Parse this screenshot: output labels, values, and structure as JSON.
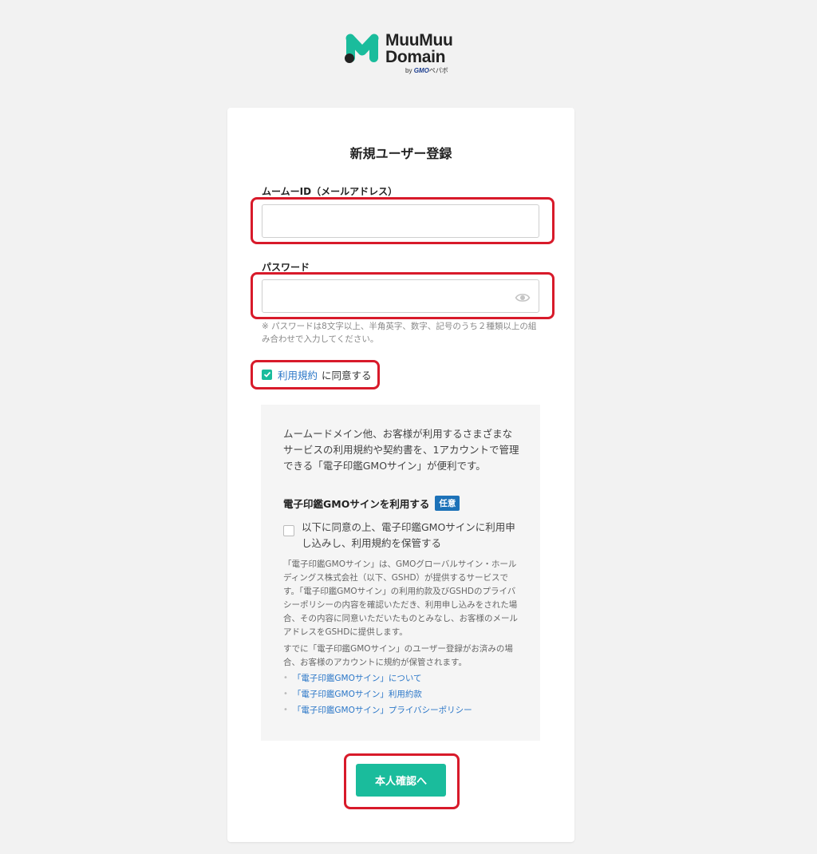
{
  "brand": {
    "name_line1": "MuuMuu",
    "name_line2": "Domain",
    "by_prefix": "by",
    "by_company": "GMO",
    "by_suffix": "ペパボ",
    "accent_color": "#1abc9c"
  },
  "form": {
    "title": "新規ユーザー登録",
    "id_label": "ムームーID（メールアドレス）",
    "id_value": "",
    "password_label": "パスワード",
    "password_value": "",
    "password_toggle_icon": "eye-icon",
    "password_hint": "※ パスワードは8文字以上、半角英字、数字、記号のうち２種類以上の組み合わせで入力してください。",
    "terms_checked": true,
    "terms_link": "利用規約",
    "terms_suffix": "に同意する",
    "submit_label": "本人確認へ"
  },
  "gmo_sign": {
    "description": "ムームードメイン他、お客様が利用するさまざまなサービスの利用規約や契約書を、1アカウントで管理できる「電子印鑑GMOサイン」が便利です。",
    "heading": "電子印鑑GMOサインを利用する",
    "badge": "任意",
    "badge_color": "#1d72b8",
    "opt_in_checked": false,
    "opt_in_label": "以下に同意の上、電子印鑑GMOサインに利用申し込みし、利用規約を保管する",
    "note1": "「電子印鑑GMOサイン」は、GMOグローバルサイン・ホールディングス株式会社（以下、GSHD）が提供するサービスです。「電子印鑑GMOサイン」の利用約款及びGSHDのプライバシーポリシーの内容を確認いただき、利用申し込みをされた場合、その内容に同意いただいたものとみなし、お客様のメールアドレスをGSHDに提供します。",
    "note2": "すでに「電子印鑑GMOサイン」のユーザー登録がお済みの場合、お客様のアカウントに規約が保管されます。",
    "links": [
      "「電子印鑑GMOサイン」について",
      "「電子印鑑GMOサイン」利用約款",
      "「電子印鑑GMOサイン」プライバシーポリシー"
    ]
  },
  "highlight_color": "#d81a2a"
}
